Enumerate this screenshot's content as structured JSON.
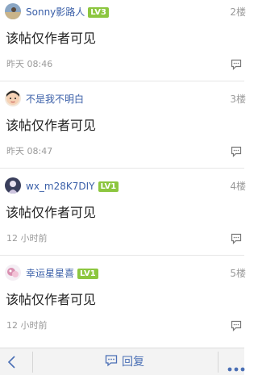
{
  "posts": [
    {
      "username": "Sonny影路人",
      "level": "LV3",
      "floor": "2楼",
      "content": "该帖仅作者可见",
      "time": "昨天 08:46"
    },
    {
      "username": "不是我不明白",
      "level": "",
      "floor": "3楼",
      "content": "该帖仅作者可见",
      "time": "昨天 08:47"
    },
    {
      "username": "wx_m28K7DIY",
      "level": "LV1",
      "floor": "4楼",
      "content": "该帖仅作者可见",
      "time": "12 小时前"
    },
    {
      "username": "幸运星星喜",
      "level": "LV1",
      "floor": "5楼",
      "content": "该帖仅作者可见",
      "time": "12 小时前"
    }
  ],
  "bottom_bar": {
    "reply_label": "回复"
  },
  "colors": {
    "username": "#3a5fa8",
    "level_badge": "#8cc63f",
    "reply_accent": "#4a6fb5"
  }
}
